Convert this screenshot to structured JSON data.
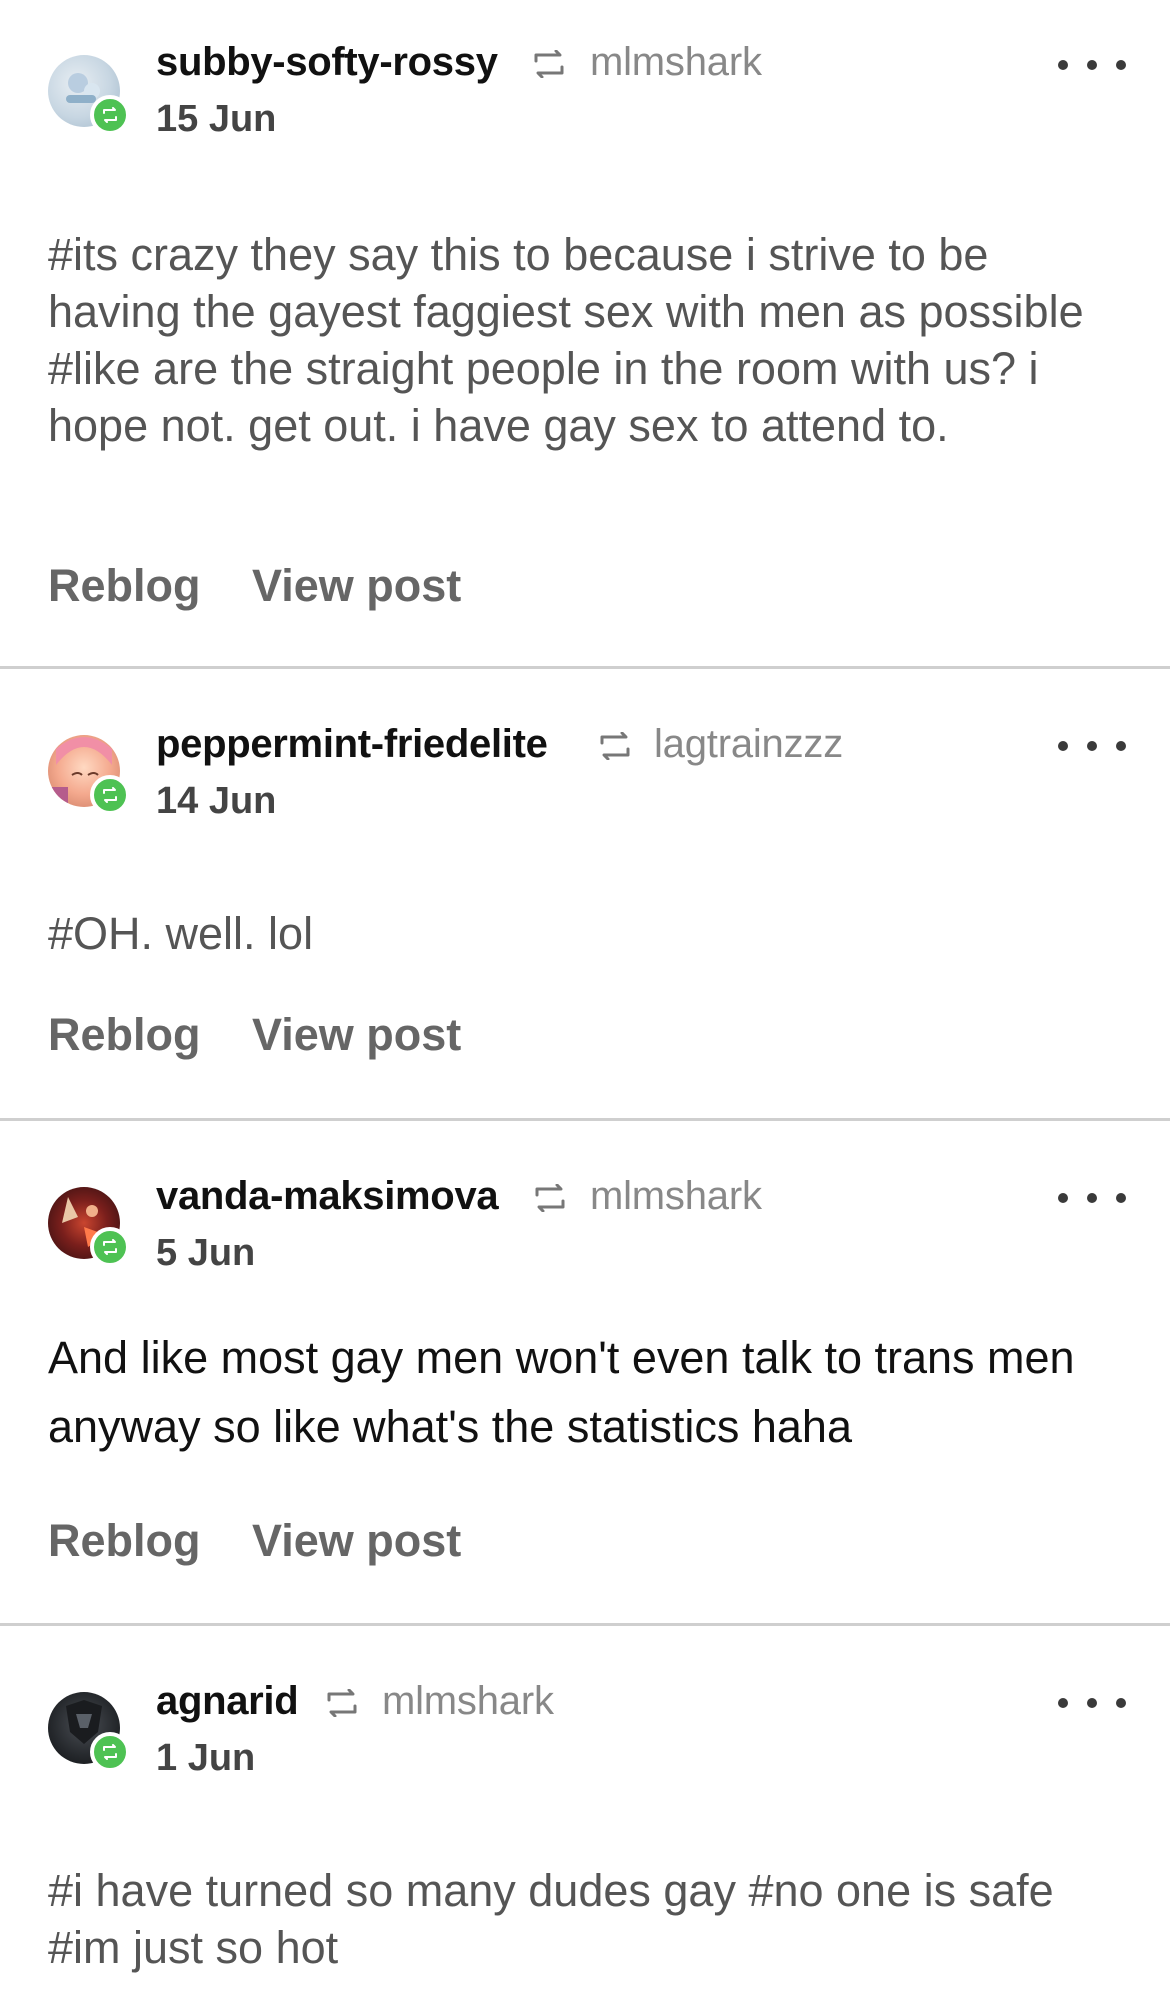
{
  "colors": {
    "badge": "#4ec253",
    "username": "#111111",
    "source": "#888888",
    "tags": "#555555",
    "actions": "#666666",
    "divider": "#cfcfcf"
  },
  "posts": [
    {
      "username": "subby-softy-rossy",
      "source": "mlmshark",
      "date": "15 Jun",
      "body": "#its crazy they say this to because i strive to be having the gayest faggiest sex with men as possible  #like are the straight people in the room with us? i hope not. get out. i have gay sex to attend to.",
      "reblog_label": "Reblog",
      "view_label": "View post",
      "avatar_icon": "avatar-image"
    },
    {
      "username": "peppermint-friedelite",
      "source": "lagtrainzzz",
      "date": "14 Jun",
      "body": "#OH. well. lol",
      "reblog_label": "Reblog",
      "view_label": "View post",
      "avatar_icon": "avatar-image"
    },
    {
      "username": "vanda-maksimova",
      "source": "mlmshark",
      "date": "5 Jun",
      "body": "And like most gay men won't even talk to trans men anyway so like what's the statistics haha",
      "reblog_label": "Reblog",
      "view_label": "View post",
      "avatar_icon": "avatar-image"
    },
    {
      "username": "agnarid",
      "source": "mlmshark",
      "date": "1 Jun",
      "body": "#i have turned so many dudes gay  #no one is safe  #im just so hot",
      "avatar_icon": "avatar-image"
    }
  ]
}
